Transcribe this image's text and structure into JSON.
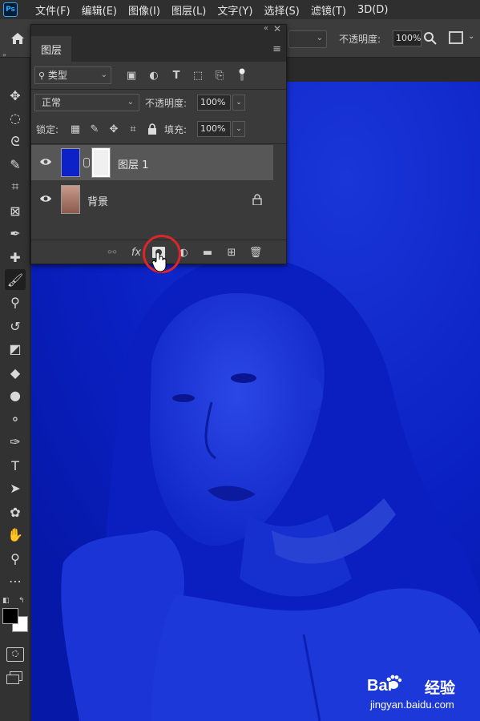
{
  "menubar": {
    "app_logo": "Ps",
    "items": [
      "文件(F)",
      "编辑(E)",
      "图像(I)",
      "图层(L)",
      "文字(Y)",
      "选择(S)",
      "滤镜(T)",
      "3D(D)"
    ]
  },
  "options": {
    "opacity_label": "不透明度:",
    "opacity_value": "100%"
  },
  "toolbar": {
    "tools": [
      {
        "name": "move-tool",
        "icon": "✥"
      },
      {
        "name": "marquee-tool",
        "icon": "◌"
      },
      {
        "name": "lasso-tool",
        "icon": "ᘓ"
      },
      {
        "name": "quick-select-tool",
        "icon": "✎"
      },
      {
        "name": "crop-tool",
        "icon": "⌗"
      },
      {
        "name": "frame-tool",
        "icon": "⊠"
      },
      {
        "name": "eyedropper-tool",
        "icon": "✒"
      },
      {
        "name": "healing-tool",
        "icon": "✚"
      },
      {
        "name": "brush-tool",
        "icon": "🖌"
      },
      {
        "name": "stamp-tool",
        "icon": "⚲"
      },
      {
        "name": "history-brush-tool",
        "icon": "↺"
      },
      {
        "name": "eraser-tool",
        "icon": "◩"
      },
      {
        "name": "paint-bucket-tool",
        "icon": "◆"
      },
      {
        "name": "blur-tool",
        "icon": "●"
      },
      {
        "name": "dodge-tool",
        "icon": "⚬"
      },
      {
        "name": "pen-tool",
        "icon": "✑"
      },
      {
        "name": "type-tool",
        "icon": "T"
      },
      {
        "name": "path-select-tool",
        "icon": "➤"
      },
      {
        "name": "custom-shape-tool",
        "icon": "✿"
      },
      {
        "name": "hand-tool",
        "icon": "✋"
      },
      {
        "name": "zoom-tool",
        "icon": "⚲"
      },
      {
        "name": "more-tools",
        "icon": "⋯"
      }
    ]
  },
  "layers_panel": {
    "tab_label": "图层",
    "filter_label": "类型",
    "blend_mode": "正常",
    "opacity_label": "不透明度:",
    "opacity_value": "100%",
    "lock_label": "锁定:",
    "fill_label": "填充:",
    "fill_value": "100%",
    "layers": [
      {
        "name": "图层 1",
        "selected": true,
        "has_mask": true
      },
      {
        "name": "背景",
        "selected": false,
        "locked": true
      }
    ],
    "bottom_fx_label": "fx"
  },
  "watermark": {
    "brand": "经验",
    "url": "jingyan.baidu.com"
  }
}
